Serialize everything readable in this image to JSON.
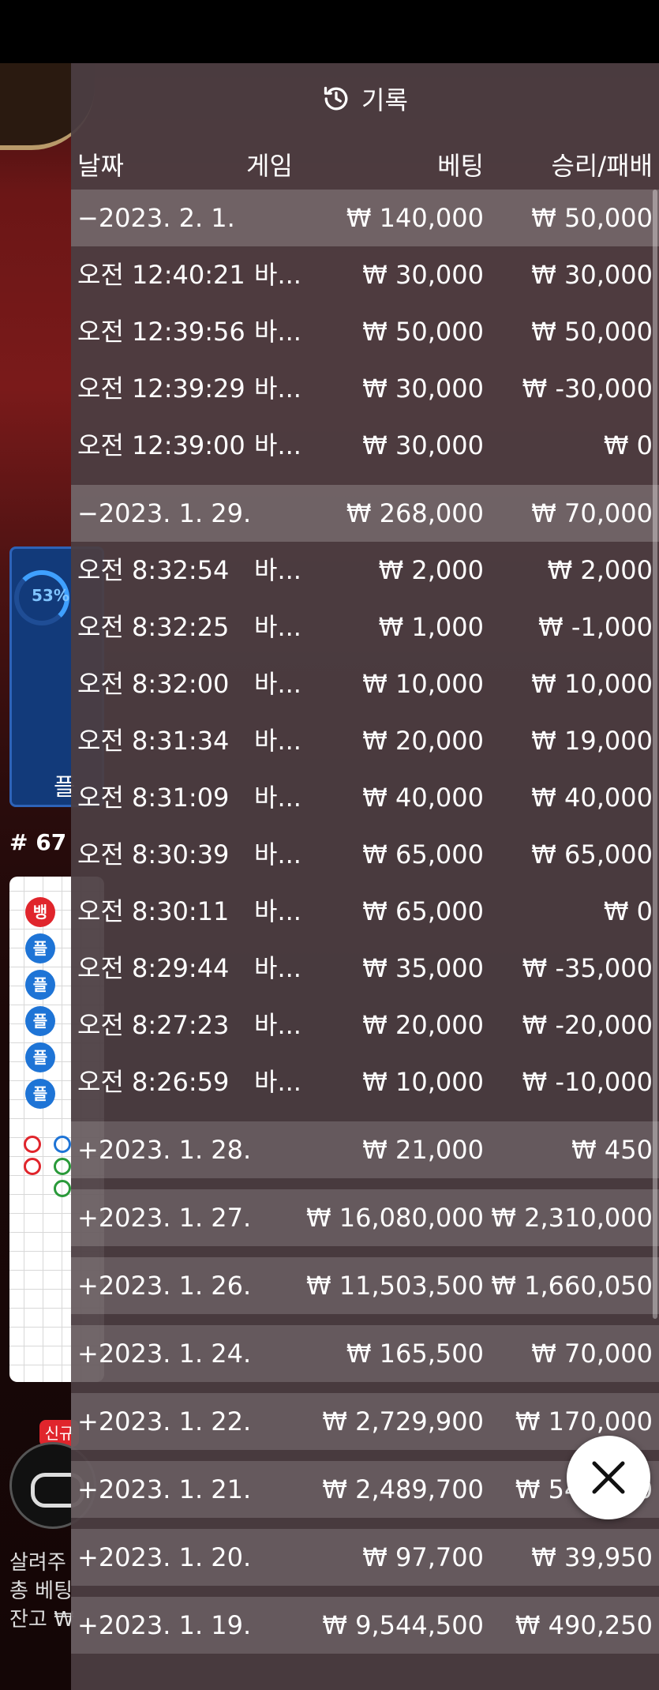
{
  "background": {
    "percent": "53%",
    "player_label": "플",
    "round": "# 67",
    "beads": [
      "뱅",
      "플",
      "플",
      "플",
      "플",
      "플"
    ],
    "new_badge": "신규",
    "line1": "살려주",
    "line2": "총 베팅",
    "line3": "잔고 ₩"
  },
  "history": {
    "title": "기록",
    "icon": "history-icon",
    "columns": {
      "date": "날짜",
      "game": "게임",
      "bet": "베팅",
      "win": "승리/패배"
    },
    "groups": [
      {
        "date": "−2023. 2. 1.",
        "bet": "₩ 140,000",
        "win": "₩ 50,000",
        "expanded": true,
        "items": [
          {
            "time": "오전 12:40:21",
            "game": "바...",
            "bet": "₩ 30,000",
            "win": "₩ 30,000"
          },
          {
            "time": "오전 12:39:56",
            "game": "바...",
            "bet": "₩ 50,000",
            "win": "₩ 50,000"
          },
          {
            "time": "오전 12:39:29",
            "game": "바...",
            "bet": "₩ 30,000",
            "win": "₩ -30,000"
          },
          {
            "time": "오전 12:39:00",
            "game": "바...",
            "bet": "₩ 30,000",
            "win": "₩ 0"
          }
        ]
      },
      {
        "date": "−2023. 1. 29.",
        "bet": "₩ 268,000",
        "win": "₩ 70,000",
        "expanded": true,
        "items": [
          {
            "time": "오전 8:32:54",
            "game": "바...",
            "bet": "₩ 2,000",
            "win": "₩ 2,000"
          },
          {
            "time": "오전 8:32:25",
            "game": "바...",
            "bet": "₩ 1,000",
            "win": "₩ -1,000"
          },
          {
            "time": "오전 8:32:00",
            "game": "바...",
            "bet": "₩ 10,000",
            "win": "₩ 10,000"
          },
          {
            "time": "오전 8:31:34",
            "game": "바...",
            "bet": "₩ 20,000",
            "win": "₩ 19,000"
          },
          {
            "time": "오전 8:31:09",
            "game": "바...",
            "bet": "₩ 40,000",
            "win": "₩ 40,000"
          },
          {
            "time": "오전 8:30:39",
            "game": "바...",
            "bet": "₩ 65,000",
            "win": "₩ 65,000"
          },
          {
            "time": "오전 8:30:11",
            "game": "바...",
            "bet": "₩ 65,000",
            "win": "₩ 0"
          },
          {
            "time": "오전 8:29:44",
            "game": "바...",
            "bet": "₩ 35,000",
            "win": "₩ -35,000"
          },
          {
            "time": "오전 8:27:23",
            "game": "바...",
            "bet": "₩ 20,000",
            "win": "₩ -20,000"
          },
          {
            "time": "오전 8:26:59",
            "game": "바...",
            "bet": "₩ 10,000",
            "win": "₩ -10,000"
          }
        ]
      },
      {
        "date": "+2023. 1. 28.",
        "bet": "₩ 21,000",
        "win": "₩ 450",
        "expanded": false,
        "items": []
      },
      {
        "date": "+2023. 1. 27.",
        "bet": "₩ 16,080,000",
        "win": "₩ 2,310,000",
        "expanded": false,
        "items": []
      },
      {
        "date": "+2023. 1. 26.",
        "bet": "₩ 11,503,500",
        "win": "₩ 1,660,050",
        "expanded": false,
        "items": []
      },
      {
        "date": "+2023. 1. 24.",
        "bet": "₩ 165,500",
        "win": "₩ 70,000",
        "expanded": false,
        "items": []
      },
      {
        "date": "+2023. 1. 22.",
        "bet": "₩ 2,729,900",
        "win": "₩ 170,000",
        "expanded": false,
        "items": []
      },
      {
        "date": "+2023. 1. 21.",
        "bet": "₩ 2,489,700",
        "win": "₩ 549,800",
        "expanded": false,
        "items": []
      },
      {
        "date": "+2023. 1. 20.",
        "bet": "₩ 97,700",
        "win": "₩ 39,950",
        "expanded": false,
        "items": []
      },
      {
        "date": "+2023. 1. 19.",
        "bet": "₩ 9,544,500",
        "win": "₩ 490,250",
        "expanded": false,
        "items": []
      }
    ],
    "close_icon": "close-icon"
  }
}
